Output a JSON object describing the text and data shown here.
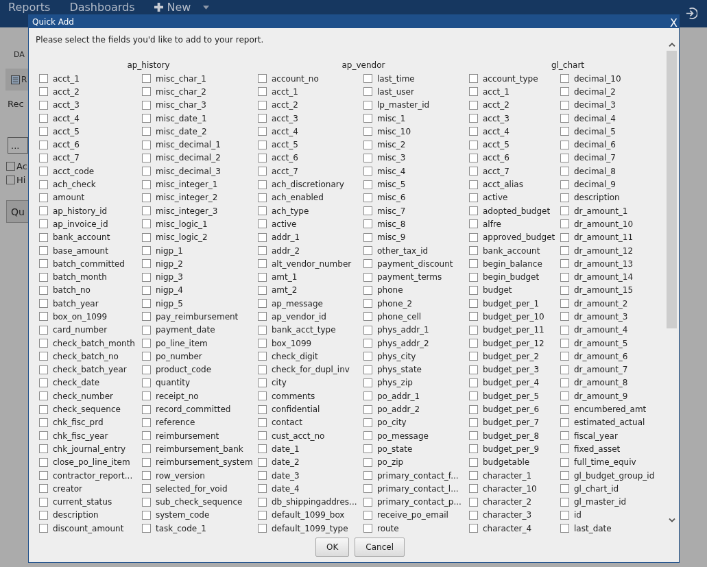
{
  "nav": {
    "items": [
      {
        "label": "Reports"
      },
      {
        "label": "Dashboards"
      },
      {
        "label": "New",
        "kind": "new"
      }
    ]
  },
  "background": {
    "tab": "DA",
    "toolbar_button": "R",
    "label": "Rec",
    "field_value": "...",
    "checkboxes": [
      {
        "label": "Ac",
        "checked": false
      },
      {
        "label": "Hi",
        "checked": false
      }
    ],
    "button": "Qu"
  },
  "dialog": {
    "title": "Quick Add",
    "close": "X",
    "instruction": "Please select the fields you'd like to add to your report.",
    "groups": [
      {
        "name": "ap_history",
        "columns": [
          [
            {
              "label": "acct_1",
              "checked": false
            },
            {
              "label": "acct_2",
              "checked": false
            },
            {
              "label": "acct_3",
              "checked": false
            },
            {
              "label": "acct_4",
              "checked": false
            },
            {
              "label": "acct_5",
              "checked": false
            },
            {
              "label": "acct_6",
              "checked": false
            },
            {
              "label": "acct_7",
              "checked": false
            },
            {
              "label": "acct_code",
              "checked": false
            },
            {
              "label": "ach_check",
              "checked": false
            },
            {
              "label": "amount",
              "checked": false
            },
            {
              "label": "ap_history_id",
              "checked": false
            },
            {
              "label": "ap_invoice_id",
              "checked": false
            },
            {
              "label": "bank_account",
              "checked": false
            },
            {
              "label": "base_amount",
              "checked": false
            },
            {
              "label": "batch_committed",
              "checked": false
            },
            {
              "label": "batch_month",
              "checked": false
            },
            {
              "label": "batch_no",
              "checked": false
            },
            {
              "label": "batch_year",
              "checked": false
            },
            {
              "label": "box_on_1099",
              "checked": false
            },
            {
              "label": "card_number",
              "checked": false
            },
            {
              "label": "check_batch_month",
              "checked": false
            },
            {
              "label": "check_batch_no",
              "checked": false
            },
            {
              "label": "check_batch_year",
              "checked": false
            },
            {
              "label": "check_date",
              "checked": false
            },
            {
              "label": "check_number",
              "checked": false
            },
            {
              "label": "check_sequence",
              "checked": false
            },
            {
              "label": "chk_fisc_prd",
              "checked": false
            },
            {
              "label": "chk_fisc_year",
              "checked": false
            },
            {
              "label": "chk_journal_entry",
              "checked": false
            },
            {
              "label": "close_po_line_item",
              "checked": false
            },
            {
              "label": "contractor_report...",
              "checked": false
            },
            {
              "label": "creator",
              "checked": false
            },
            {
              "label": "current_status",
              "checked": false
            },
            {
              "label": "description",
              "checked": false
            },
            {
              "label": "discount_amount",
              "checked": false
            }
          ],
          [
            {
              "label": "misc_char_1",
              "checked": false
            },
            {
              "label": "misc_char_2",
              "checked": false
            },
            {
              "label": "misc_char_3",
              "checked": false
            },
            {
              "label": "misc_date_1",
              "checked": false
            },
            {
              "label": "misc_date_2",
              "checked": false
            },
            {
              "label": "misc_decimal_1",
              "checked": false
            },
            {
              "label": "misc_decimal_2",
              "checked": false
            },
            {
              "label": "misc_decimal_3",
              "checked": false
            },
            {
              "label": "misc_integer_1",
              "checked": false
            },
            {
              "label": "misc_integer_2",
              "checked": false
            },
            {
              "label": "misc_integer_3",
              "checked": false
            },
            {
              "label": "misc_logic_1",
              "checked": false
            },
            {
              "label": "misc_logic_2",
              "checked": false
            },
            {
              "label": "nigp_1",
              "checked": false
            },
            {
              "label": "nigp_2",
              "checked": false
            },
            {
              "label": "nigp_3",
              "checked": false
            },
            {
              "label": "nigp_4",
              "checked": false
            },
            {
              "label": "nigp_5",
              "checked": false
            },
            {
              "label": "pay_reimbursement",
              "checked": false
            },
            {
              "label": "payment_date",
              "checked": false
            },
            {
              "label": "po_line_item",
              "checked": false
            },
            {
              "label": "po_number",
              "checked": false
            },
            {
              "label": "product_code",
              "checked": false
            },
            {
              "label": "quantity",
              "checked": false
            },
            {
              "label": "receipt_no",
              "checked": false
            },
            {
              "label": "record_committed",
              "checked": false
            },
            {
              "label": "reference",
              "checked": false
            },
            {
              "label": "reimbursement",
              "checked": false
            },
            {
              "label": "reimbursement_bank",
              "checked": false
            },
            {
              "label": "reimbursement_system",
              "checked": false
            },
            {
              "label": "row_version",
              "checked": false
            },
            {
              "label": "selected_for_void",
              "checked": false
            },
            {
              "label": "sub_check_sequence",
              "checked": false
            },
            {
              "label": "system_code",
              "checked": false
            },
            {
              "label": "task_code_1",
              "checked": false
            }
          ]
        ]
      },
      {
        "name": "ap_vendor",
        "columns": [
          [
            {
              "label": "account_no",
              "checked": false
            },
            {
              "label": "acct_1",
              "checked": false
            },
            {
              "label": "acct_2",
              "checked": false
            },
            {
              "label": "acct_3",
              "checked": false
            },
            {
              "label": "acct_4",
              "checked": false
            },
            {
              "label": "acct_5",
              "checked": false
            },
            {
              "label": "acct_6",
              "checked": false
            },
            {
              "label": "acct_7",
              "checked": false
            },
            {
              "label": "ach_discretionary",
              "checked": false
            },
            {
              "label": "ach_enabled",
              "checked": false
            },
            {
              "label": "ach_type",
              "checked": false
            },
            {
              "label": "active",
              "checked": false
            },
            {
              "label": "addr_1",
              "checked": false
            },
            {
              "label": "addr_2",
              "checked": false
            },
            {
              "label": "alt_vendor_number",
              "checked": false
            },
            {
              "label": "amt_1",
              "checked": false
            },
            {
              "label": "amt_2",
              "checked": false
            },
            {
              "label": "ap_message",
              "checked": false
            },
            {
              "label": "ap_vendor_id",
              "checked": false
            },
            {
              "label": "bank_acct_type",
              "checked": false
            },
            {
              "label": "box_1099",
              "checked": false
            },
            {
              "label": "check_digit",
              "checked": false
            },
            {
              "label": "check_for_dupl_inv",
              "checked": false
            },
            {
              "label": "city",
              "checked": false
            },
            {
              "label": "comments",
              "checked": false
            },
            {
              "label": "confidential",
              "checked": false
            },
            {
              "label": "contact",
              "checked": false
            },
            {
              "label": "cust_acct_no",
              "checked": false
            },
            {
              "label": "date_1",
              "checked": false
            },
            {
              "label": "date_2",
              "checked": false
            },
            {
              "label": "date_3",
              "checked": false
            },
            {
              "label": "date_4",
              "checked": false
            },
            {
              "label": "db_shippingaddres...",
              "checked": false
            },
            {
              "label": "default_1099_box",
              "checked": false
            },
            {
              "label": "default_1099_type",
              "checked": false
            }
          ],
          [
            {
              "label": "last_time",
              "checked": false
            },
            {
              "label": "last_user",
              "checked": false
            },
            {
              "label": "lp_master_id",
              "checked": false
            },
            {
              "label": "misc_1",
              "checked": false
            },
            {
              "label": "misc_10",
              "checked": false
            },
            {
              "label": "misc_2",
              "checked": false
            },
            {
              "label": "misc_3",
              "checked": false
            },
            {
              "label": "misc_4",
              "checked": false
            },
            {
              "label": "misc_5",
              "checked": false
            },
            {
              "label": "misc_6",
              "checked": false
            },
            {
              "label": "misc_7",
              "checked": false
            },
            {
              "label": "misc_8",
              "checked": false
            },
            {
              "label": "misc_9",
              "checked": false
            },
            {
              "label": "other_tax_id",
              "checked": false
            },
            {
              "label": "payment_discount",
              "checked": false
            },
            {
              "label": "payment_terms",
              "checked": false
            },
            {
              "label": "phone",
              "checked": false
            },
            {
              "label": "phone_2",
              "checked": false
            },
            {
              "label": "phone_cell",
              "checked": false
            },
            {
              "label": "phys_addr_1",
              "checked": false
            },
            {
              "label": "phys_addr_2",
              "checked": false
            },
            {
              "label": "phys_city",
              "checked": false
            },
            {
              "label": "phys_state",
              "checked": false
            },
            {
              "label": "phys_zip",
              "checked": false
            },
            {
              "label": "po_addr_1",
              "checked": false
            },
            {
              "label": "po_addr_2",
              "checked": false
            },
            {
              "label": "po_city",
              "checked": false
            },
            {
              "label": "po_message",
              "checked": false
            },
            {
              "label": "po_state",
              "checked": false
            },
            {
              "label": "po_zip",
              "checked": false
            },
            {
              "label": "primary_contact_f...",
              "checked": false
            },
            {
              "label": "primary_contact_l...",
              "checked": false
            },
            {
              "label": "primary_contact_p...",
              "checked": false
            },
            {
              "label": "receive_po_email",
              "checked": false
            },
            {
              "label": "route",
              "checked": false
            }
          ]
        ]
      },
      {
        "name": "gl_chart",
        "columns": [
          [
            {
              "label": "account_type",
              "checked": false
            },
            {
              "label": "acct_1",
              "checked": false
            },
            {
              "label": "acct_2",
              "checked": false
            },
            {
              "label": "acct_3",
              "checked": false
            },
            {
              "label": "acct_4",
              "checked": false
            },
            {
              "label": "acct_5",
              "checked": false
            },
            {
              "label": "acct_6",
              "checked": false
            },
            {
              "label": "acct_7",
              "checked": false
            },
            {
              "label": "acct_alias",
              "checked": false
            },
            {
              "label": "active",
              "checked": false
            },
            {
              "label": "adopted_budget",
              "checked": false
            },
            {
              "label": "alfre",
              "checked": false
            },
            {
              "label": "approved_budget",
              "checked": false
            },
            {
              "label": "bank_account",
              "checked": false
            },
            {
              "label": "begin_balance",
              "checked": false
            },
            {
              "label": "begin_budget",
              "checked": false
            },
            {
              "label": "budget",
              "checked": false
            },
            {
              "label": "budget_per_1",
              "checked": false
            },
            {
              "label": "budget_per_10",
              "checked": false
            },
            {
              "label": "budget_per_11",
              "checked": false
            },
            {
              "label": "budget_per_12",
              "checked": false
            },
            {
              "label": "budget_per_2",
              "checked": false
            },
            {
              "label": "budget_per_3",
              "checked": false
            },
            {
              "label": "budget_per_4",
              "checked": false
            },
            {
              "label": "budget_per_5",
              "checked": false
            },
            {
              "label": "budget_per_6",
              "checked": false
            },
            {
              "label": "budget_per_7",
              "checked": false
            },
            {
              "label": "budget_per_8",
              "checked": false
            },
            {
              "label": "budget_per_9",
              "checked": false
            },
            {
              "label": "budgetable",
              "checked": false
            },
            {
              "label": "character_1",
              "checked": false
            },
            {
              "label": "character_10",
              "checked": false
            },
            {
              "label": "character_2",
              "checked": false
            },
            {
              "label": "character_3",
              "checked": false
            },
            {
              "label": "character_4",
              "checked": false
            }
          ],
          [
            {
              "label": "decimal_10",
              "checked": false
            },
            {
              "label": "decimal_2",
              "checked": false
            },
            {
              "label": "decimal_3",
              "checked": false
            },
            {
              "label": "decimal_4",
              "checked": false
            },
            {
              "label": "decimal_5",
              "checked": false
            },
            {
              "label": "decimal_6",
              "checked": false
            },
            {
              "label": "decimal_7",
              "checked": false
            },
            {
              "label": "decimal_8",
              "checked": false
            },
            {
              "label": "decimal_9",
              "checked": false
            },
            {
              "label": "description",
              "checked": false
            },
            {
              "label": "dr_amount_1",
              "checked": false
            },
            {
              "label": "dr_amount_10",
              "checked": false
            },
            {
              "label": "dr_amount_11",
              "checked": false
            },
            {
              "label": "dr_amount_12",
              "checked": false
            },
            {
              "label": "dr_amount_13",
              "checked": false
            },
            {
              "label": "dr_amount_14",
              "checked": false
            },
            {
              "label": "dr_amount_15",
              "checked": false
            },
            {
              "label": "dr_amount_2",
              "checked": false
            },
            {
              "label": "dr_amount_3",
              "checked": false
            },
            {
              "label": "dr_amount_4",
              "checked": false
            },
            {
              "label": "dr_amount_5",
              "checked": false
            },
            {
              "label": "dr_amount_6",
              "checked": false
            },
            {
              "label": "dr_amount_7",
              "checked": false
            },
            {
              "label": "dr_amount_8",
              "checked": false
            },
            {
              "label": "dr_amount_9",
              "checked": false
            },
            {
              "label": "encumbered_amt",
              "checked": false
            },
            {
              "label": "estimated_actual",
              "checked": false
            },
            {
              "label": "fiscal_year",
              "checked": false
            },
            {
              "label": "fixed_asset",
              "checked": false
            },
            {
              "label": "full_time_equiv",
              "checked": false
            },
            {
              "label": "gl_budget_group_id",
              "checked": false
            },
            {
              "label": "gl_chart_id",
              "checked": false
            },
            {
              "label": "gl_master_id",
              "checked": false
            },
            {
              "label": "id",
              "checked": false
            },
            {
              "label": "last_date",
              "checked": false
            }
          ]
        ]
      }
    ],
    "buttons": [
      {
        "label": "OK"
      },
      {
        "label": "Cancel"
      }
    ]
  }
}
